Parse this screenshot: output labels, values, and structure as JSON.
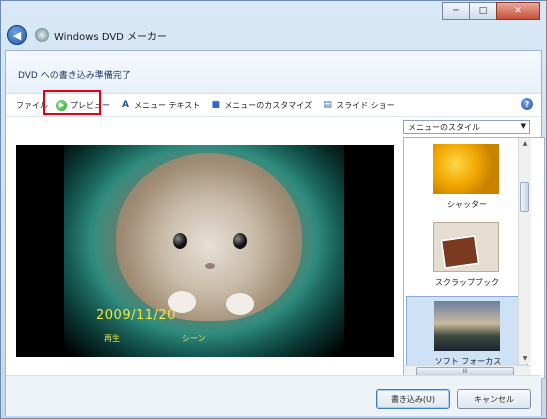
{
  "window": {
    "title": "Windows DVD メーカー",
    "controls": {
      "minimize": "─",
      "maximize": "□",
      "close": "✕"
    },
    "back_glyph": "◀"
  },
  "header": {
    "status": "DVD への書き込み準備完了"
  },
  "toolbar": {
    "items": [
      {
        "label": "ファイル",
        "icon": "none"
      },
      {
        "label": "プレビュー",
        "icon": "play-icon",
        "glyph": "▶"
      },
      {
        "label": "メニュー テキスト",
        "icon": "text-icon",
        "glyph": "A"
      },
      {
        "label": "メニューのカスタマイズ",
        "icon": "customize-icon",
        "glyph": "■"
      },
      {
        "label": "スライド ショー",
        "icon": "slideshow-icon",
        "glyph": "▤"
      }
    ],
    "help_glyph": "?"
  },
  "preview": {
    "date": "2009/11/20",
    "options": [
      "再生",
      "シーン"
    ]
  },
  "styles": {
    "select_label": "メニューのスタイル",
    "select_arrow": "▼",
    "items": [
      {
        "label": "シャッター",
        "selected": false
      },
      {
        "label": "スクラップブック",
        "selected": false
      },
      {
        "label": "ソフト フォーカス",
        "selected": true
      }
    ],
    "hscroll_grip": "III"
  },
  "footer": {
    "write_button": "書き込み(U)",
    "cancel_button": "キャンセル"
  },
  "colors": {
    "accent": "#2352a5",
    "highlight": "#e0001a",
    "date_text": "#f2e73a"
  }
}
